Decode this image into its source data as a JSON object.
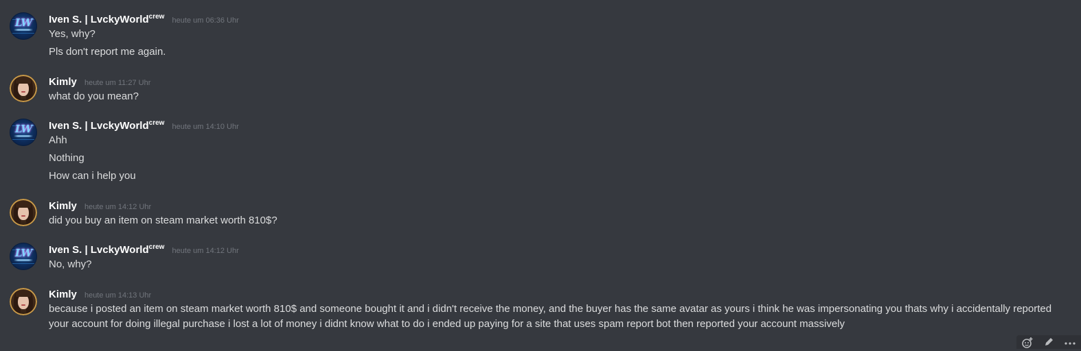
{
  "messages": [
    {
      "author": "Iven S. | LvckyWorld",
      "tag": "crew",
      "timestamp": "heute um 06:36 Uhr",
      "avatar": "lvckyworld-logo",
      "lines": [
        "Yes, why?",
        "Pls don't report me again."
      ]
    },
    {
      "author": "Kimly",
      "timestamp": "heute um 11:27 Uhr",
      "avatar": "kimly-photo",
      "lines": [
        "what do you mean?"
      ]
    },
    {
      "author": "Iven S. | LvckyWorld",
      "tag": "crew",
      "timestamp": "heute um 14:10 Uhr",
      "avatar": "lvckyworld-logo",
      "lines": [
        "Ahh",
        "Nothing",
        "How can i help you"
      ]
    },
    {
      "author": "Kimly",
      "timestamp": "heute um 14:12 Uhr",
      "avatar": "kimly-photo",
      "lines": [
        "did you buy an item on steam market worth 810$?"
      ]
    },
    {
      "author": "Iven S. | LvckyWorld",
      "tag": "crew",
      "timestamp": "heute um 14:12 Uhr",
      "avatar": "lvckyworld-logo",
      "lines": [
        "No, why?"
      ]
    },
    {
      "author": "Kimly",
      "timestamp": "heute um 14:13 Uhr",
      "avatar": "kimly-photo",
      "lines": [
        "because i posted an item on steam market worth 810$ and someone bought it and i didn't receive the money, and the buyer has the same avatar as yours i think he was impersonating you thats why i accidentally reported",
        "your account for doing illegal purchase i lost a lot of money i didnt know what to do i ended up paying for a site  that uses spam report bot then reported your account massively"
      ]
    }
  ],
  "toolbar": {
    "icons": [
      "add-reaction-icon",
      "edit-icon",
      "more-options-icon"
    ]
  },
  "colors": {
    "background": "#36393f",
    "username": "#ffffff",
    "timestamp": "#72767d",
    "text": "#dcddde"
  }
}
